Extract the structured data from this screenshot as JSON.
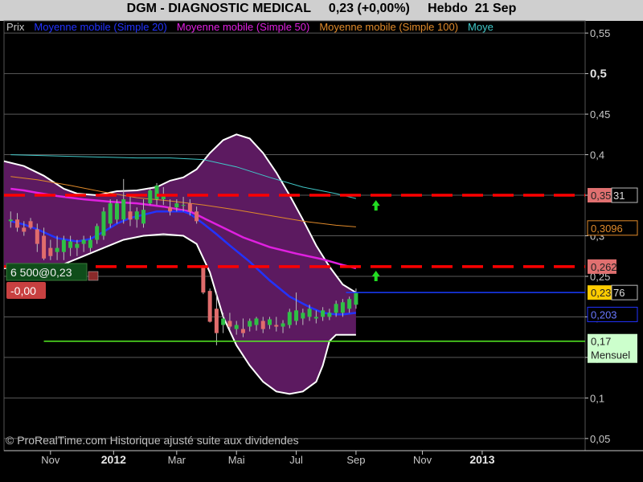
{
  "header": {
    "title": "DGM - DIAGNOSTIC MEDICAL     0,23 (+0,00%)     Hebdo  21 Sep"
  },
  "legend": [
    {
      "label": "Prix",
      "color": "#c8c8c8"
    },
    {
      "label": "Moyenne mobile (Simple 20)",
      "color": "#2233ff"
    },
    {
      "label": "Moyenne mobile (Simple 50)",
      "color": "#e020e0"
    },
    {
      "label": "Moyenne mobile (Simple 100)",
      "color": "#e08a2a"
    },
    {
      "label": "Moye",
      "color": "#40c8c8"
    }
  ],
  "order_box": {
    "text": "6 500@0,23",
    "pnl": "-0,00"
  },
  "footer": {
    "copyright": "© ProRealTime.com Historique ajusté suite aux dividendes"
  },
  "colors": {
    "background": "#000000",
    "band_fill": "#5c1a60",
    "up_candle": "#2fbf45",
    "down_candle": "#e06c6c",
    "sma20": "#2233ff",
    "sma50": "#e020e0",
    "sma100": "#e08a2a",
    "sma200": "#40c8c8",
    "resistance": "#ff0000",
    "blue_level": "#1a3cff",
    "green_level": "#55ee22",
    "arrow": "#22dd22"
  },
  "chart_data": {
    "type": "candlestick",
    "period": "weekly",
    "ylim": [
      0.035,
      0.565
    ],
    "y_ticks": [
      "0,55",
      "0,5",
      "0,45",
      "0,4",
      "0,35",
      "0,3",
      "0,25",
      "0,2",
      "0,15",
      "0,1",
      "0,05"
    ],
    "y_tick_values": [
      0.55,
      0.5,
      0.45,
      0.4,
      0.35,
      0.3,
      0.25,
      0.2,
      0.15,
      0.1,
      0.05
    ],
    "x_ticks": [
      {
        "label": "Nov",
        "week": 7,
        "bold": false
      },
      {
        "label": "2012",
        "week": 16.5,
        "bold": true
      },
      {
        "label": "Mar",
        "week": 26,
        "bold": false
      },
      {
        "label": "Mai",
        "week": 35,
        "bold": false
      },
      {
        "label": "Jul",
        "week": 44,
        "bold": false
      },
      {
        "label": "Sep",
        "week": 53,
        "bold": false
      },
      {
        "label": "Nov",
        "week": 63,
        "bold": false
      },
      {
        "label": "2013",
        "week": 72,
        "bold": true
      }
    ],
    "candles": [
      {
        "week": 1,
        "o": 0.318,
        "h": 0.33,
        "l": 0.31,
        "c": 0.32
      },
      {
        "week": 2,
        "o": 0.32,
        "h": 0.328,
        "l": 0.305,
        "c": 0.31
      },
      {
        "week": 3,
        "o": 0.31,
        "h": 0.318,
        "l": 0.3,
        "c": 0.305
      },
      {
        "week": 4,
        "o": 0.318,
        "h": 0.322,
        "l": 0.308,
        "c": 0.31
      },
      {
        "week": 5,
        "o": 0.308,
        "h": 0.315,
        "l": 0.28,
        "c": 0.29
      },
      {
        "week": 6,
        "o": 0.3,
        "h": 0.31,
        "l": 0.27,
        "c": 0.272
      },
      {
        "week": 7,
        "o": 0.285,
        "h": 0.295,
        "l": 0.27,
        "c": 0.275
      },
      {
        "week": 8,
        "o": 0.28,
        "h": 0.3,
        "l": 0.27,
        "c": 0.285
      },
      {
        "week": 9,
        "o": 0.28,
        "h": 0.3,
        "l": 0.27,
        "c": 0.295
      },
      {
        "week": 10,
        "o": 0.285,
        "h": 0.3,
        "l": 0.275,
        "c": 0.293
      },
      {
        "week": 11,
        "o": 0.285,
        "h": 0.295,
        "l": 0.275,
        "c": 0.29
      },
      {
        "week": 12,
        "o": 0.29,
        "h": 0.3,
        "l": 0.28,
        "c": 0.295
      },
      {
        "week": 13,
        "o": 0.285,
        "h": 0.3,
        "l": 0.28,
        "c": 0.295
      },
      {
        "week": 14,
        "o": 0.295,
        "h": 0.315,
        "l": 0.29,
        "c": 0.312
      },
      {
        "week": 15,
        "o": 0.3,
        "h": 0.335,
        "l": 0.295,
        "c": 0.33
      },
      {
        "week": 16,
        "o": 0.315,
        "h": 0.345,
        "l": 0.31,
        "c": 0.34
      },
      {
        "week": 17,
        "o": 0.32,
        "h": 0.345,
        "l": 0.315,
        "c": 0.34
      },
      {
        "week": 18,
        "o": 0.32,
        "h": 0.37,
        "l": 0.315,
        "c": 0.345
      },
      {
        "week": 19,
        "o": 0.33,
        "h": 0.35,
        "l": 0.312,
        "c": 0.32
      },
      {
        "week": 20,
        "o": 0.32,
        "h": 0.335,
        "l": 0.31,
        "c": 0.33
      },
      {
        "week": 21,
        "o": 0.315,
        "h": 0.345,
        "l": 0.31,
        "c": 0.332
      },
      {
        "week": 22,
        "o": 0.34,
        "h": 0.358,
        "l": 0.338,
        "c": 0.356
      },
      {
        "week": 23,
        "o": 0.345,
        "h": 0.365,
        "l": 0.338,
        "c": 0.362
      },
      {
        "week": 24,
        "o": 0.345,
        "h": 0.36,
        "l": 0.338,
        "c": 0.35
      },
      {
        "week": 25,
        "o": 0.335,
        "h": 0.345,
        "l": 0.325,
        "c": 0.33
      },
      {
        "week": 26,
        "o": 0.335,
        "h": 0.345,
        "l": 0.33,
        "c": 0.34
      },
      {
        "week": 27,
        "o": 0.338,
        "h": 0.348,
        "l": 0.33,
        "c": 0.338
      },
      {
        "week": 28,
        "o": 0.34,
        "h": 0.345,
        "l": 0.325,
        "c": 0.33
      },
      {
        "week": 29,
        "o": 0.33,
        "h": 0.336,
        "l": 0.315,
        "c": 0.318
      },
      {
        "week": 30,
        "o": 0.262,
        "h": 0.264,
        "l": 0.228,
        "c": 0.23
      },
      {
        "week": 31,
        "o": 0.232,
        "h": 0.235,
        "l": 0.193,
        "c": 0.194
      },
      {
        "week": 32,
        "o": 0.21,
        "h": 0.23,
        "l": 0.165,
        "c": 0.18
      },
      {
        "week": 33,
        "o": 0.19,
        "h": 0.205,
        "l": 0.18,
        "c": 0.198
      },
      {
        "week": 34,
        "o": 0.195,
        "h": 0.205,
        "l": 0.185,
        "c": 0.188
      },
      {
        "week": 35,
        "o": 0.185,
        "h": 0.195,
        "l": 0.178,
        "c": 0.19
      },
      {
        "week": 36,
        "o": 0.185,
        "h": 0.198,
        "l": 0.175,
        "c": 0.18
      },
      {
        "week": 37,
        "o": 0.188,
        "h": 0.198,
        "l": 0.182,
        "c": 0.195
      },
      {
        "week": 38,
        "o": 0.19,
        "h": 0.2,
        "l": 0.183,
        "c": 0.198
      },
      {
        "week": 39,
        "o": 0.195,
        "h": 0.2,
        "l": 0.18,
        "c": 0.185
      },
      {
        "week": 40,
        "o": 0.19,
        "h": 0.2,
        "l": 0.185,
        "c": 0.197
      },
      {
        "week": 41,
        "o": 0.19,
        "h": 0.2,
        "l": 0.182,
        "c": 0.188
      },
      {
        "week": 42,
        "o": 0.188,
        "h": 0.196,
        "l": 0.18,
        "c": 0.192
      },
      {
        "week": 43,
        "o": 0.19,
        "h": 0.21,
        "l": 0.186,
        "c": 0.206
      },
      {
        "week": 44,
        "o": 0.195,
        "h": 0.23,
        "l": 0.19,
        "c": 0.208
      },
      {
        "week": 45,
        "o": 0.198,
        "h": 0.21,
        "l": 0.19,
        "c": 0.205
      },
      {
        "week": 46,
        "o": 0.2,
        "h": 0.215,
        "l": 0.195,
        "c": 0.21
      },
      {
        "week": 47,
        "o": 0.198,
        "h": 0.208,
        "l": 0.192,
        "c": 0.2
      },
      {
        "week": 48,
        "o": 0.2,
        "h": 0.212,
        "l": 0.195,
        "c": 0.208
      },
      {
        "week": 49,
        "o": 0.2,
        "h": 0.21,
        "l": 0.196,
        "c": 0.205
      },
      {
        "week": 50,
        "o": 0.205,
        "h": 0.22,
        "l": 0.2,
        "c": 0.216
      },
      {
        "week": 51,
        "o": 0.205,
        "h": 0.222,
        "l": 0.2,
        "c": 0.218
      },
      {
        "week": 52,
        "o": 0.21,
        "h": 0.225,
        "l": 0.205,
        "c": 0.222
      },
      {
        "week": 53,
        "o": 0.215,
        "h": 0.235,
        "l": 0.21,
        "c": 0.23
      }
    ],
    "series": [
      {
        "name": "Moyenne mobile (Simple 20)",
        "color": "#2233ff",
        "points": [
          [
            1,
            0.318
          ],
          [
            3,
            0.314
          ],
          [
            5,
            0.308
          ],
          [
            8,
            0.297
          ],
          [
            11,
            0.293
          ],
          [
            13,
            0.296
          ],
          [
            15,
            0.305
          ],
          [
            17,
            0.315
          ],
          [
            19,
            0.322
          ],
          [
            21,
            0.326
          ],
          [
            23,
            0.33
          ],
          [
            25,
            0.33
          ],
          [
            27,
            0.33
          ],
          [
            28,
            0.327
          ],
          [
            30,
            0.315
          ],
          [
            32,
            0.302
          ],
          [
            34,
            0.288
          ],
          [
            37,
            0.268
          ],
          [
            40,
            0.245
          ],
          [
            43,
            0.225
          ],
          [
            46,
            0.212
          ],
          [
            48,
            0.205
          ],
          [
            50,
            0.203
          ],
          [
            51,
            0.203
          ],
          [
            53,
            0.205
          ]
        ]
      },
      {
        "name": "Moyenne mobile (Simple 50)",
        "color": "#e020e0",
        "points": [
          [
            1,
            0.358
          ],
          [
            3,
            0.356
          ],
          [
            5,
            0.353
          ],
          [
            8,
            0.349
          ],
          [
            12,
            0.345
          ],
          [
            16,
            0.342
          ],
          [
            20,
            0.34
          ],
          [
            24,
            0.336
          ],
          [
            28,
            0.33
          ],
          [
            30,
            0.322
          ],
          [
            33,
            0.31
          ],
          [
            36,
            0.298
          ],
          [
            40,
            0.286
          ],
          [
            44,
            0.278
          ],
          [
            48,
            0.271
          ],
          [
            51,
            0.264
          ],
          [
            53,
            0.26
          ]
        ]
      },
      {
        "name": "Moyenne mobile (Simple 100)",
        "color": "#e08a2a",
        "points": [
          [
            1,
            0.373
          ],
          [
            5,
            0.369
          ],
          [
            10,
            0.362
          ],
          [
            15,
            0.354
          ],
          [
            20,
            0.347
          ],
          [
            25,
            0.343
          ],
          [
            30,
            0.338
          ],
          [
            35,
            0.332
          ],
          [
            40,
            0.325
          ],
          [
            45,
            0.318
          ],
          [
            50,
            0.313
          ],
          [
            53,
            0.311
          ]
        ]
      },
      {
        "name": "Moye",
        "color": "#40c8c8",
        "points": [
          [
            1,
            0.4
          ],
          [
            10,
            0.398
          ],
          [
            20,
            0.396
          ],
          [
            25,
            0.396
          ],
          [
            30,
            0.394
          ],
          [
            35,
            0.385
          ],
          [
            40,
            0.372
          ],
          [
            45,
            0.36
          ],
          [
            50,
            0.352
          ],
          [
            53,
            0.346
          ]
        ]
      }
    ],
    "band_upper": [
      [
        0,
        0.392
      ],
      [
        3,
        0.386
      ],
      [
        6,
        0.374
      ],
      [
        9,
        0.358
      ],
      [
        11,
        0.352
      ],
      [
        14,
        0.35
      ],
      [
        17,
        0.355
      ],
      [
        20,
        0.356
      ],
      [
        23,
        0.36
      ],
      [
        25,
        0.368
      ],
      [
        27,
        0.372
      ],
      [
        29,
        0.382
      ],
      [
        31,
        0.402
      ],
      [
        33,
        0.418
      ],
      [
        35,
        0.425
      ],
      [
        37,
        0.42
      ],
      [
        39,
        0.402
      ],
      [
        41,
        0.378
      ],
      [
        43,
        0.35
      ],
      [
        45,
        0.32
      ],
      [
        47,
        0.288
      ],
      [
        49,
        0.262
      ],
      [
        51,
        0.24
      ],
      [
        53,
        0.23
      ]
    ],
    "band_lower": [
      [
        0,
        0.26
      ],
      [
        3,
        0.258
      ],
      [
        6,
        0.26
      ],
      [
        9,
        0.265
      ],
      [
        12,
        0.275
      ],
      [
        15,
        0.285
      ],
      [
        18,
        0.295
      ],
      [
        21,
        0.3
      ],
      [
        24,
        0.302
      ],
      [
        27,
        0.3
      ],
      [
        29,
        0.29
      ],
      [
        31,
        0.255
      ],
      [
        33,
        0.2
      ],
      [
        35,
        0.165
      ],
      [
        37,
        0.14
      ],
      [
        39,
        0.12
      ],
      [
        41,
        0.108
      ],
      [
        43,
        0.105
      ],
      [
        45,
        0.108
      ],
      [
        47,
        0.12
      ],
      [
        48,
        0.14
      ],
      [
        49,
        0.17
      ],
      [
        50,
        0.178
      ],
      [
        51,
        0.178
      ],
      [
        53,
        0.178
      ]
    ],
    "levels": [
      {
        "value": 0.35,
        "label": "0,35",
        "color": "#ff0000",
        "dashed": true,
        "label_bg": "#e07070",
        "suffix": "31"
      },
      {
        "value": 0.262,
        "label": "0,262",
        "color": "#ff0000",
        "dashed": true,
        "label_bg": "#e07070",
        "suffix": ""
      },
      {
        "value": 0.23,
        "label": "0,23",
        "color": "#1a3cff",
        "dashed": false,
        "label_bg": "#ffcc00",
        "suffix": "76"
      },
      {
        "value": 0.17,
        "label": "0,17",
        "color": "#55ee22",
        "dashed": false,
        "label_bg": "#ccffcc",
        "suffix": "",
        "sub": "Mensuel"
      }
    ],
    "value_labels": [
      {
        "value": 0.3096,
        "label": "0,3096",
        "color": "#e08a2a"
      },
      {
        "value": 0.203,
        "label": "0,203",
        "color": "#2233ff"
      }
    ],
    "arrows": [
      {
        "week": 56,
        "value": 0.337
      },
      {
        "week": 56,
        "value": 0.25
      }
    ]
  }
}
